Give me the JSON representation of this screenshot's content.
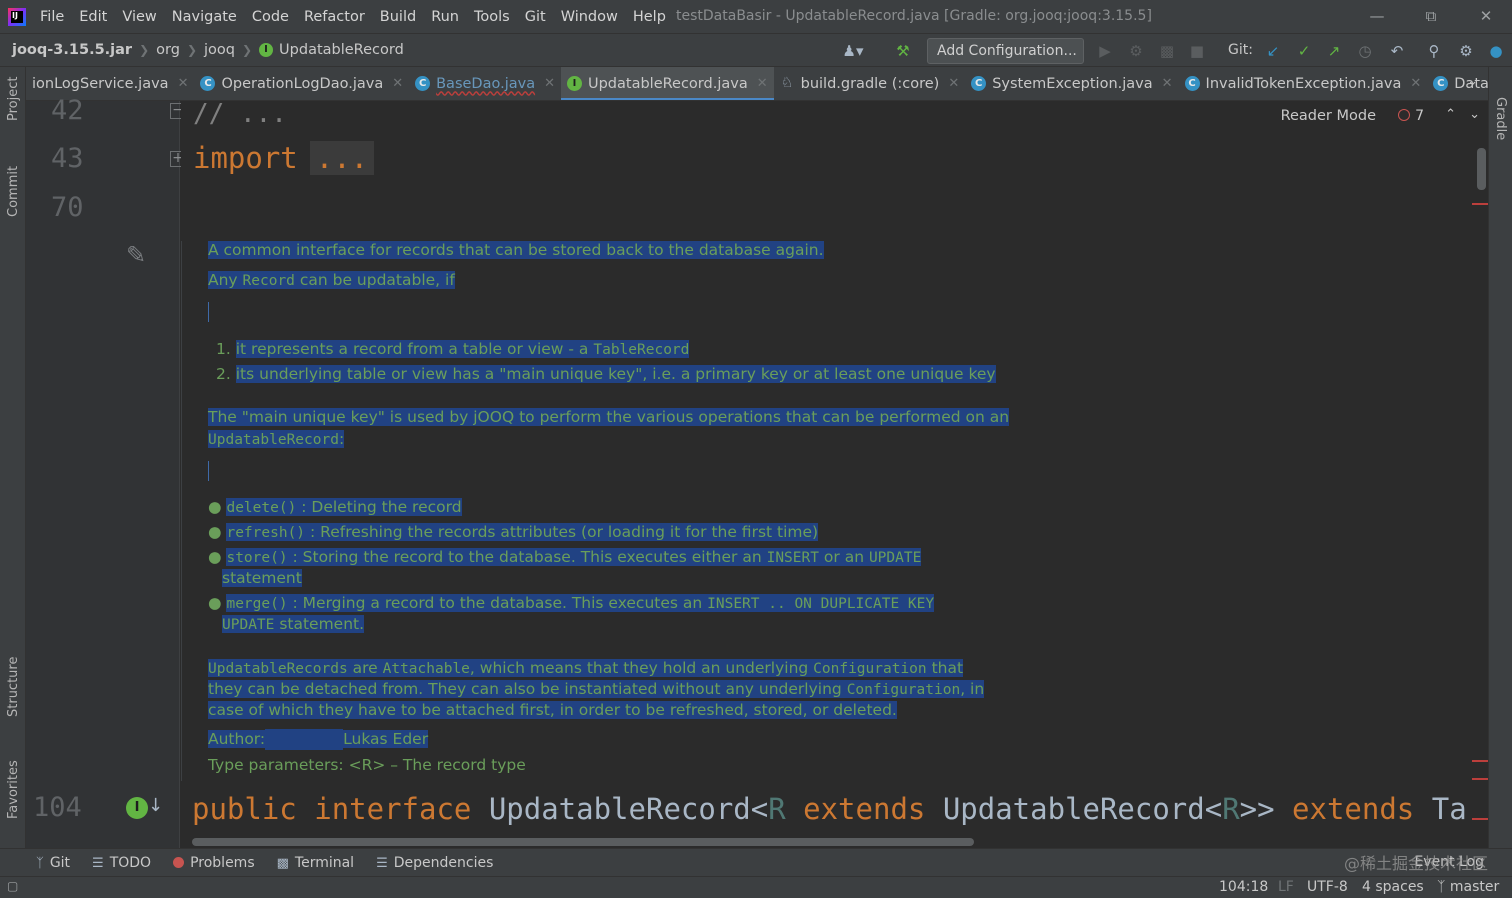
{
  "menu": {
    "items": [
      "File",
      "Edit",
      "View",
      "Navigate",
      "Code",
      "Refactor",
      "Build",
      "Run",
      "Tools",
      "Git",
      "Window",
      "Help"
    ],
    "window_title": "testDataBasir - UpdatableRecord.java [Gradle: org.jooq:jooq:3.15.5]"
  },
  "breadcrumb": {
    "jar": "jooq-3.15.5.jar",
    "pkg1": "org",
    "pkg2": "jooq",
    "file": "UpdatableRecord"
  },
  "toolbar": {
    "add_configuration": "Add Configuration...",
    "git_label": "Git:"
  },
  "tabs": [
    {
      "label": "ionLogService.java",
      "kind": "none"
    },
    {
      "label": "OperationLogDao.java",
      "kind": "class"
    },
    {
      "label": "BaseDao.java",
      "kind": "class"
    },
    {
      "label": "UpdatableRecord.java",
      "kind": "interface",
      "active": true
    },
    {
      "label": "build.gradle (:core)",
      "kind": "gradle"
    },
    {
      "label": "SystemException.java",
      "kind": "class"
    },
    {
      "label": "InvalidTokenException.java",
      "kind": "class"
    },
    {
      "label": "Databa",
      "kind": "class"
    }
  ],
  "side_tools": {
    "project": "Project",
    "commit": "Commit",
    "structure": "Structure",
    "favorites": "Favorites",
    "gradle": "Gradle"
  },
  "editor": {
    "reader_mode": "Reader Mode",
    "problem_count": "7",
    "line_numbers": {
      "l42": "42",
      "l43": "43",
      "l70": "70",
      "l104": "104"
    },
    "line42_text": "// ...",
    "import_kw": "import",
    "import_fold": "...",
    "declaration": {
      "public": "public",
      "interface": "interface",
      "name": "UpdatableRecord<",
      "R1": "R",
      "extends1": "extends",
      "bound": "UpdatableRecord<",
      "R2": "R",
      "close": ">>",
      "extends2": "extends",
      "super": "Ta"
    }
  },
  "doc": {
    "p1": "A common interface for records that can be stored back to the database again.",
    "p2_a": "Any ",
    "p2_code": "Record",
    "p2_b": " can be updatable, if",
    "ol1_num": "1.",
    "ol1_text": "it represents a record from a table or view - a ",
    "ol1_code": "TableRecord",
    "ol2_num": "2.",
    "ol2_text": "its underlying table or view has a \"main unique key\", i.e. a primary key or at least one unique key",
    "p3_a": "The \"main unique key\" is used by jOOQ to perform the various operations that can be performed on an",
    "p3_code": "UpdatableRecord",
    "p3_b": ":",
    "b1_code": "delete()",
    "b1_text": " : Deleting the record",
    "b2_code": "refresh()",
    "b2_text": " : Refreshing the records attributes (or loading it for the first time)",
    "b3_code": "store()",
    "b3_text_a": " : Storing the record to the database. This executes either an ",
    "b3_code2": "INSERT",
    "b3_text_b": " or an ",
    "b3_code3": "UPDATE",
    "b3_line2": "statement",
    "b4_code": "merge()",
    "b4_text_a": " : Merging a record to the database. This executes an ",
    "b4_code2": "INSERT .. ON DUPLICATE KEY",
    "b4_line2_code": "UPDATE",
    "b4_line2_text": " statement.",
    "p4_code1": "UpdatableRecords",
    "p4_t1": " are ",
    "p4_code2": "Attachable",
    "p4_t2": ", which means that they hold an underlying ",
    "p4_code3": "Configuration",
    "p4_t3": " that",
    "p4_line2_a": "they can be detached from. They can also be instantiated without any underlying ",
    "p4_line2_code": "Configuration",
    "p4_line2_b": ", in",
    "p4_line3": "case of which they have to be attached first, in order to be refreshed, stored, or deleted.",
    "author_label": "Author:",
    "author_name": "Lukas Eder",
    "type_params": "Type parameters:  <R> – The record type"
  },
  "bottom_tools": {
    "git": "Git",
    "todo": "TODO",
    "problems": "Problems",
    "terminal": "Terminal",
    "dependencies": "Dependencies",
    "event_log": "Event Log"
  },
  "status": {
    "position": "104:18",
    "line_sep": "LF",
    "encoding": "UTF-8",
    "indent": "4 spaces",
    "branch": "master"
  },
  "watermark": "@稀土掘金技术社区"
}
